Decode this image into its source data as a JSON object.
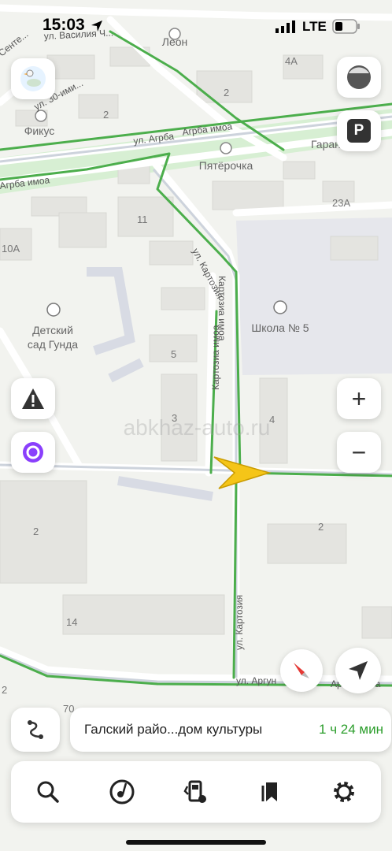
{
  "status_bar": {
    "time": "15:03",
    "network": "LTE"
  },
  "map": {
    "watermark": "abkhaz-auto.ru",
    "streets": [
      "ул. Василия Ч...",
      "Сенте...",
      "ул. Агрба",
      "Агрба имоа",
      "Агрба имоа",
      "ул. Картозия",
      "Картозиа имоа",
      "Картозиа имоа",
      "ул. Картозия",
      "ул. Аргун",
      "Аргун имоа",
      "ул. 30-ими..."
    ],
    "pois": [
      {
        "name": "Леон"
      },
      {
        "name": "Фикус"
      },
      {
        "name": "Пятёрочка"
      },
      {
        "name": "Гаран..."
      },
      {
        "name": "Детский сад Гунда",
        "line1": "Детский",
        "line2": "сад Гунда"
      },
      {
        "name": "Школа № 5"
      }
    ],
    "house_numbers": [
      "4А",
      "2",
      "2",
      "23А",
      "11",
      "10А",
      "5",
      "3",
      "4",
      "2",
      "2",
      "14",
      "70",
      "2"
    ]
  },
  "controls": {
    "layers_icon": "layers-icon",
    "parking_label": "P",
    "zoom_in": "+",
    "zoom_out": "−"
  },
  "route": {
    "destination": "Галский райо...дом культуры",
    "eta": "1 ч 24 мин"
  },
  "tabs": [
    {
      "name": "search-icon"
    },
    {
      "name": "music-icon"
    },
    {
      "name": "fuel-icon"
    },
    {
      "name": "bookmarks-icon"
    },
    {
      "name": "settings-icon"
    }
  ],
  "colors": {
    "route": "#4cae4c",
    "arrow": "#f5c518",
    "eta": "#2a9d2a",
    "green_area": "#d7efd3",
    "alice": "#8a3ffc"
  }
}
